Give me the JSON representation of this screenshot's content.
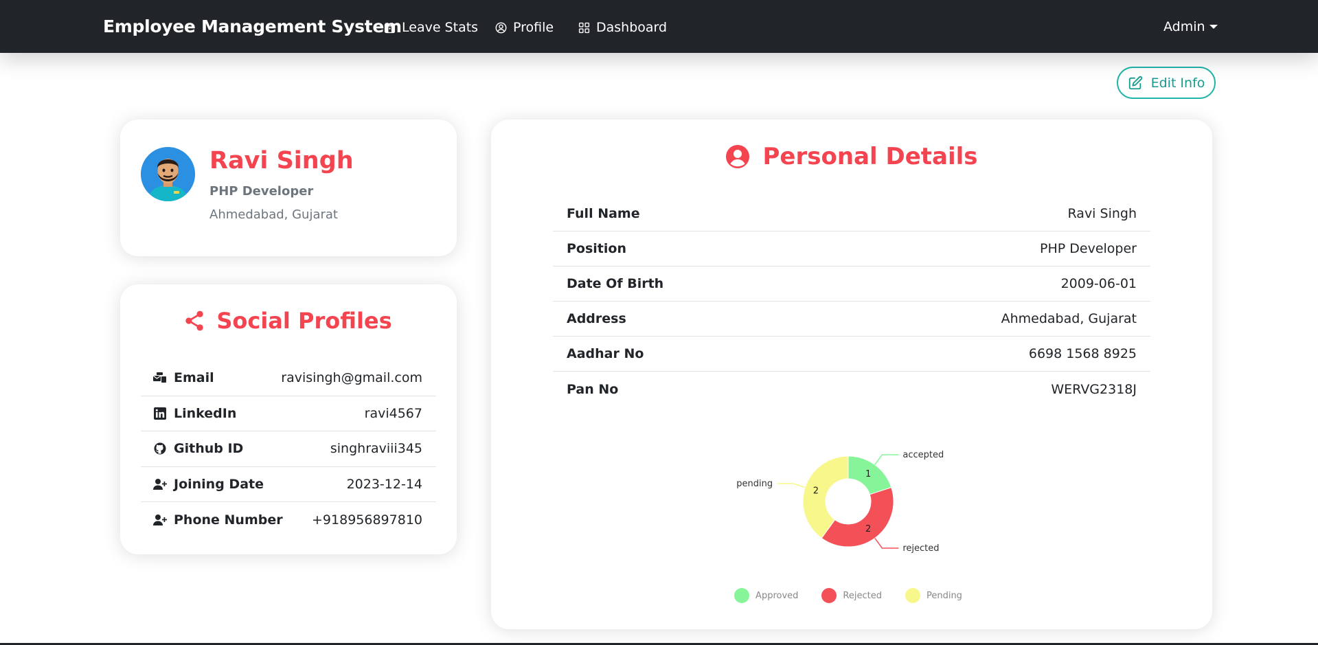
{
  "navbar": {
    "brand": "Employee Management System",
    "links": [
      {
        "label": "Leave Stats",
        "icon": "calendar-icon"
      },
      {
        "label": "Profile",
        "icon": "user-circle-icon"
      },
      {
        "label": "Dashboard",
        "icon": "grid-icon"
      }
    ],
    "admin": "Admin"
  },
  "edit_button": {
    "label": "Edit Info",
    "icon": "edit-icon"
  },
  "profile": {
    "name": "Ravi Singh",
    "role": "PHP Developer",
    "location": "Ahmedabad, Gujarat"
  },
  "social": {
    "title": "Social Profiles",
    "rows": [
      {
        "label": "Email",
        "value": "ravisingh@gmail.com",
        "icon": "mail-icon"
      },
      {
        "label": "LinkedIn",
        "value": "ravi4567",
        "icon": "linkedin-icon"
      },
      {
        "label": "Github ID",
        "value": "singhraviii345",
        "icon": "github-icon"
      },
      {
        "label": "Joining Date",
        "value": "2023-12-14",
        "icon": "user-plus-icon"
      },
      {
        "label": "Phone Number",
        "value": "+918956897810",
        "icon": "user-plus-icon"
      }
    ]
  },
  "details": {
    "title": "Personal Details",
    "rows": [
      {
        "label": "Full Name",
        "value": "Ravi Singh"
      },
      {
        "label": "Position",
        "value": "PHP Developer"
      },
      {
        "label": "Date Of Birth",
        "value": "2009-06-01"
      },
      {
        "label": "Address",
        "value": "Ahmedabad, Gujarat"
      },
      {
        "label": "Aadhar No",
        "value": "6698 1568 8925"
      },
      {
        "label": "Pan No",
        "value": "WERVG2318J"
      }
    ]
  },
  "colors": {
    "accent": "#f4444f",
    "navbar": "#212529",
    "teal": "#1fb5a8"
  },
  "chart_data": {
    "type": "pie",
    "variant": "doughnut",
    "slices": [
      {
        "category": "accepted",
        "legend": "Approved",
        "value": 1,
        "color": "#86f59a"
      },
      {
        "category": "rejected",
        "legend": "Rejected",
        "value": 2,
        "color": "#f45058"
      },
      {
        "category": "pending",
        "legend": "Pending",
        "value": 2,
        "color": "#f8f78c"
      }
    ],
    "legend_position": "bottom"
  }
}
